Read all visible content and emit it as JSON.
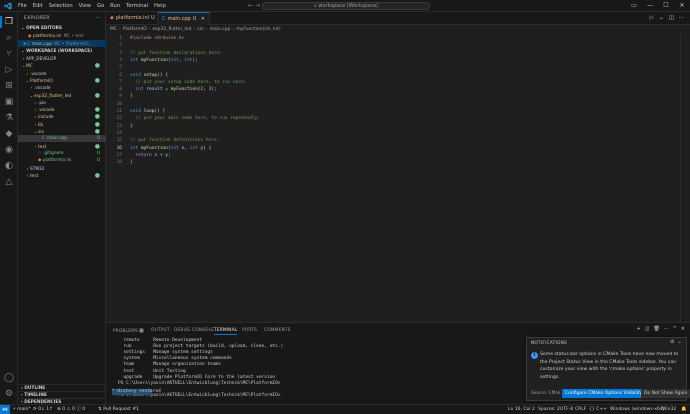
{
  "window": {
    "menus": [
      "File",
      "Edit",
      "Selection",
      "View",
      "Go",
      "Run",
      "Terminal",
      "Help"
    ],
    "command_center": "workspace (Workspace)"
  },
  "explorer": {
    "title": "EXPLORER",
    "open_editors_label": "OPEN EDITORS",
    "open_editors": [
      {
        "name": "platformio.ini",
        "desc": "MC • test"
      },
      {
        "name": "main.cpp",
        "desc": "MC • PlatformIO..."
      }
    ],
    "workspace_label": "WORKSPACE (WORKSPACE)",
    "tree": [
      {
        "name": "APP_DEVELOP",
        "twisty": "›",
        "indent": 0,
        "status": ""
      },
      {
        "name": "MC",
        "twisty": "⌄",
        "indent": 0,
        "status": "●"
      },
      {
        "name": ".vscode",
        "twisty": "›",
        "indent": 1,
        "status": ""
      },
      {
        "name": "PlatformIO",
        "twisty": "⌄",
        "indent": 1,
        "status": "●"
      },
      {
        "name": ".vscode",
        "twisty": "›",
        "indent": 2,
        "status": ""
      },
      {
        "name": "esp32_flutter_led",
        "twisty": "⌄",
        "indent": 2,
        "status": "●"
      },
      {
        "name": ".pio",
        "twisty": "›",
        "indent": 3,
        "status": ""
      },
      {
        "name": ".vscode",
        "twisty": "›",
        "indent": 3,
        "status": "●"
      },
      {
        "name": "include",
        "twisty": "›",
        "indent": 3,
        "status": "●"
      },
      {
        "name": "lib",
        "twisty": "›",
        "indent": 3,
        "status": "●"
      },
      {
        "name": "src",
        "twisty": "⌄",
        "indent": 3,
        "status": "●"
      },
      {
        "name": "main.cpp",
        "twisty": "",
        "indent": 4,
        "status": "U"
      },
      {
        "name": "test",
        "twisty": "›",
        "indent": 3,
        "status": "●"
      },
      {
        "name": ".gitignore",
        "twisty": "",
        "indent": 3,
        "status": "U"
      },
      {
        "name": "platformio.ini",
        "twisty": "",
        "indent": 3,
        "status": "U"
      },
      {
        "name": "STM32",
        "twisty": "›",
        "indent": 1,
        "status": ""
      },
      {
        "name": "test",
        "twisty": "›",
        "indent": 1,
        "status": "●"
      }
    ],
    "outline_label": "OUTLINE",
    "timeline_label": "TIMELINE",
    "dependencies_label": "DEPENDENCIES"
  },
  "tabs": [
    {
      "name": "platformio.ini",
      "modified": "U"
    },
    {
      "name": "main.cpp",
      "modified": "U"
    }
  ],
  "breadcrumb": [
    "MC",
    "PlatformIO",
    "esp32_flutter_led",
    "src",
    "main.cpp",
    "myFunction(int, int)"
  ],
  "code_lines": [
    "#include <Arduino.h>",
    "",
    "// put function declarations here:",
    "int myFunction(int, int);",
    "",
    "void setup() {",
    "  // put your setup code here, to run once:",
    "  int result = myFunction(2, 3);",
    "}",
    "",
    "void loop() {",
    "  // put your main code here, to run repeatedly:",
    "}",
    "",
    "// put function definitions here:",
    "int myFunction(int x, int y) {",
    "  return x + y;",
    "}"
  ],
  "panel": {
    "tabs": [
      "PROBLEMS",
      "OUTPUT",
      "DEBUG CONSOLE",
      "TERMINAL",
      "PORTS",
      "COMMENTS"
    ],
    "problems_count": "1",
    "terminal_lines": [
      "  remote     Remote Development",
      "  run        Run project targets (build, upload, clean, etc.)",
      "  settings   Manage system settings",
      "  system     Miscellaneous system commands",
      "  team       Manage organization teams",
      "  test       Unit Testing",
      "  upgrade    Upgrade PlatformIO Core to the latest version",
      "PS C:\\Users\\yasin\\AKTUELL\\Entwicklung\\Technik\\MC\\PlatformIO>",
      "",
      "PS C:\\Users\\yasin\\AKTUELL\\Entwicklung\\Technik\\MC\\PlatformIO>"
    ],
    "terminal_highlight": "* History restored"
  },
  "notification": {
    "header": "NOTIFICATIONS",
    "message": "Some status bar options in CMake Tools have now moved to the Project Status View in the CMake Tools sidebar. You can customize your view with the 'cmake.options' property in settings.",
    "source": "Source: CMak...",
    "primary_button": "Configure CMake Options Visibility",
    "secondary_button": "Do Not Show Again"
  },
  "statusbar": {
    "branch": "main*",
    "sync": "0↓ 1↑",
    "errors": "0",
    "warnings": "0",
    "info": "0",
    "pr": "Pull Request #1",
    "position": "Ln 16, Col 2",
    "spaces": "Spaces: 2",
    "encoding": "UTF-8",
    "eol": "CRLF",
    "language": "C++",
    "platform": "Windows (windows-x64)",
    "config": "Win32"
  },
  "colors": {
    "accent": "#0078d4",
    "untracked": "#73c991",
    "modified": "#e2c08d"
  }
}
